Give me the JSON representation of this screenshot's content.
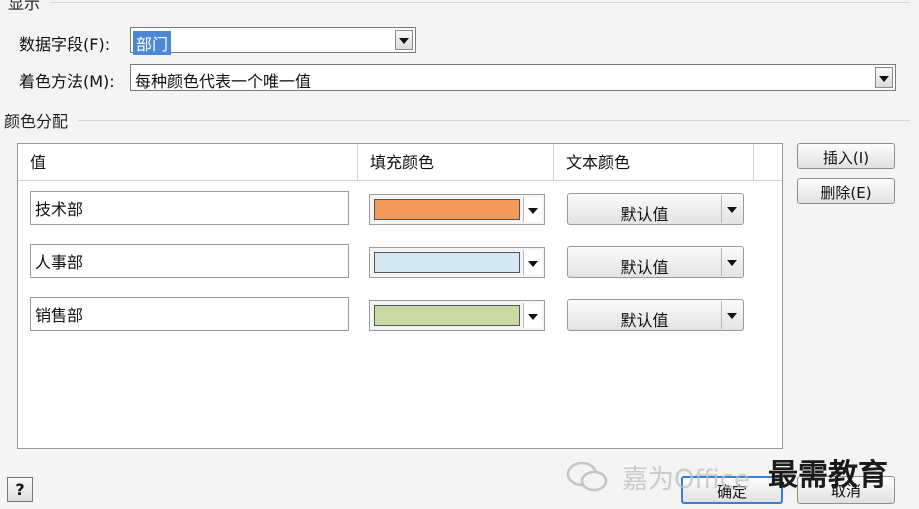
{
  "display_section": {
    "title": "显示"
  },
  "data_field": {
    "label": "数据字段(F):",
    "value": "部门"
  },
  "coloring_method": {
    "label": "着色方法(M):",
    "value": "每种颜色代表一个唯一值"
  },
  "color_assignment": {
    "title": "颜色分配"
  },
  "table": {
    "headers": {
      "value": "值",
      "fill": "填充颜色",
      "text": "文本颜色"
    },
    "rows": [
      {
        "value": "技术部",
        "fill_color": "#f39a5a",
        "text_color": "默认值"
      },
      {
        "value": "人事部",
        "fill_color": "#d4eaf2",
        "text_color": "默认值"
      },
      {
        "value": "销售部",
        "fill_color": "#cbd9a4",
        "text_color": "默认值"
      }
    ]
  },
  "buttons": {
    "insert": "插入(I)",
    "delete": "删除(E)",
    "ok": "确定",
    "cancel": "取消",
    "help": "?"
  },
  "watermark": {
    "text": "嘉为Office",
    "brand": "最需教育"
  }
}
